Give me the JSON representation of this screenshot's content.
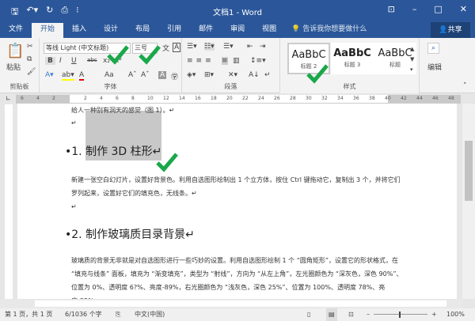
{
  "titlebar": {
    "title": "文档1 - Word",
    "qa": [
      "save-icon",
      "undo-icon",
      "redo-icon",
      "print-preview-icon",
      "customize-icon"
    ]
  },
  "tabs": [
    "文件",
    "开始",
    "插入",
    "设计",
    "布局",
    "引用",
    "邮件",
    "审阅",
    "视图"
  ],
  "active_tab": "开始",
  "tell_me": "告诉我你想要做什么",
  "share": "共享",
  "ribbon": {
    "clipboard": {
      "paste": "粘贴",
      "label": "剪贴板"
    },
    "font": {
      "name": "等线 Light (中文标题)",
      "size": "三号",
      "label": "字体",
      "buttons": [
        "B",
        "I",
        "U",
        "abc",
        "x₂",
        "x²",
        "A",
        "A",
        "Aa"
      ]
    },
    "paragraph": {
      "label": "段落"
    },
    "styles": {
      "label": "样式",
      "items": [
        {
          "sample": "AaBbC",
          "name": "标题 2"
        },
        {
          "sample": "AaBbC",
          "name": "标题 3"
        },
        {
          "sample": "AaBbC",
          "name": "标题"
        }
      ]
    },
    "editing": {
      "label": "编辑"
    }
  },
  "ruler": {
    "left": [
      "6",
      "4",
      "2"
    ],
    "right": [
      "2",
      "4",
      "6",
      "8",
      "10",
      "12",
      "14",
      "16",
      "18",
      "20",
      "22",
      "24",
      "26",
      "28",
      "30",
      "32",
      "34",
      "36",
      "38",
      "40",
      "42",
      "44",
      "46",
      "48"
    ]
  },
  "document": {
    "line1": "给人一种别有洞天的感觉（图 1）。↵",
    "heading1": "•1. 制作 3D 柱形↵",
    "para1": "新建一张空白幻灯片，设置好背景色。利用自选图形绘制出 1 个立方体，按住 Ctrl 键拖动它，复制出 3 个，并将它们罗列起来，设置好它们的填充色，无线条。↵",
    "heading2": "•2. 制作玻璃质目录背景↵",
    "para2": "玻璃质的背景无非就是对自选图形进行一些巧妙的设置。利用自选图形绘制 1 个 “圆角矩形”，设置它的形状格式，在 “填充与线条” 面板，填充为 “渐变填充”，类型为 “射线”，方向为 “从左上角”，左光圈颜色为 “深灰色，深色 90%”、位置为 0%、透明度 6?%、亮度-89%，右光圈颜色为 “浅灰色，深色 25%”、位置为 100%、透明度 78%、亮度-35%，"
  },
  "status": {
    "page": "第 1 页，共 1 页",
    "words": "6/1036 个字",
    "language": "中文(中国)",
    "zoom": "100%",
    "zoom_level_percent": 100
  },
  "colors": {
    "brand": "#2b579a",
    "check": "#1aa84a"
  }
}
